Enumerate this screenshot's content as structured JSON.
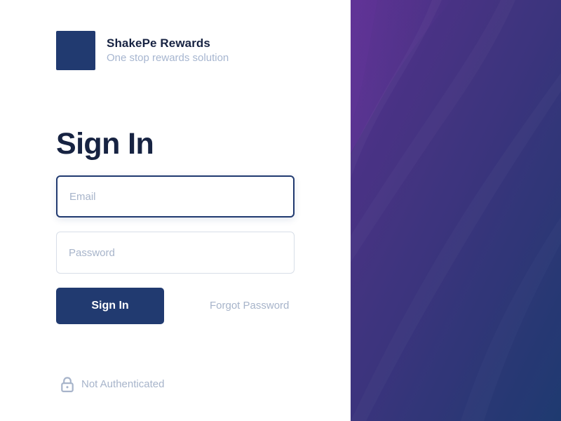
{
  "brand": {
    "name": "ShakePe Rewards",
    "tagline": "One stop rewards solution",
    "logo_color": "#213a70"
  },
  "page": {
    "title": "Sign In"
  },
  "form": {
    "email": {
      "value": "",
      "placeholder": "Email",
      "state": "focused"
    },
    "password": {
      "value": "",
      "placeholder": "Password"
    },
    "submit_label": "Sign In",
    "forgot_password_label": "Forgot Password"
  },
  "status": {
    "icon": "lock-icon",
    "text": "Not Authenticated"
  },
  "theme": {
    "primary": "#213a70",
    "heading": "#172342",
    "muted": "#a7b4ca",
    "input_border": "#d8dee8",
    "side_panel_top": "#5a2f8d",
    "side_panel_bottom": "#203a70"
  }
}
